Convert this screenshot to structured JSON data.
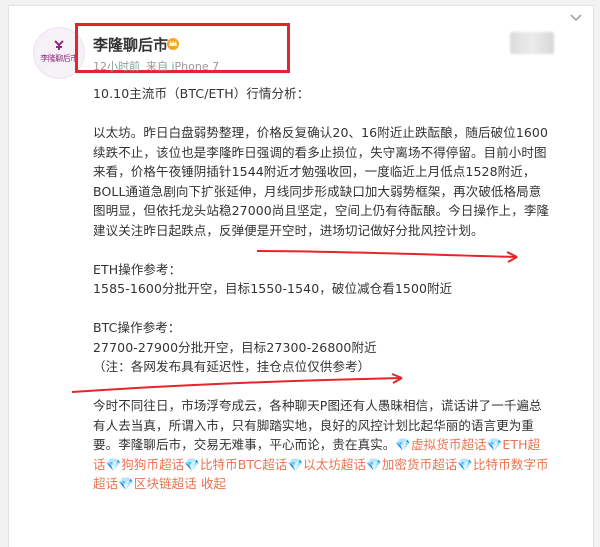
{
  "user": {
    "name": "李隆聊后市",
    "avatar_text": "李隆聊后市",
    "meta_time": "12小时前",
    "meta_source": "来自 iPhone 7"
  },
  "post": {
    "title": "10.10主流币（BTC/ETH）行情分析：",
    "para1_lines": [
      "以太坊。昨日白盘弱势整理，价格反复确认20、16附近止跌酝酿，随后破位1600",
      "续跌不止，该位也是李隆昨日强调的看多止损位，失守离场不得停留。目前小时图",
      "来看，价格午夜锤阴插针1544附近才勉强收回，一度临近上月低点1528附近，",
      "BOLL通道急剧向下扩张延伸，月线同步形成缺口加大弱势框架，再次破低格局意",
      "图明显，但依托龙头站稳27000尚且坚定，空间上仍有待酝酿。今日操作上，李隆",
      "建议关注昨日起跌点，反弹便是开空时，进场切记做好分批风控计划。"
    ],
    "eth_title": "ETH操作参考：",
    "eth_line": "1585-1600分批开空，目标1550-1540，破位减仓看1500附近",
    "btc_title": "BTC操作参考：",
    "btc_line": "27700-27900分批开空，目标27300-26800附近",
    "note": "（注：各网发布具有延迟性，挂仓点位仅供参考）",
    "para2_lines": [
      "今时不同往日，市场浮夸成云，各种聊天P图还有人愚昧相信，谎话讲了一千遍总",
      "有人去当真，所谓入市，只有脚踏实地，良好的风控计划比起华丽的语言更为重",
      "要。李隆聊后市，交易无难事，平心而论，贵在真实。"
    ],
    "tags_line1_tail": [
      "💎虚拟货币超话",
      "💎ETH超"
    ],
    "tags_line2": [
      "话",
      "💎狗狗币超话",
      "💎比特币BTC超话",
      "💎以太坊超话",
      "💎加密货币超话",
      "💎比特币数字币"
    ],
    "tags_line3": [
      "超话",
      "💎区块链超话"
    ],
    "collapse_label": "收起"
  },
  "colors": {
    "accent": "#eb7350",
    "highlight_box": "#e5242b",
    "arrow": "#e5242b"
  },
  "icons": [
    "crown-icon",
    "chevron-down-icon",
    "arrow-annotation"
  ]
}
